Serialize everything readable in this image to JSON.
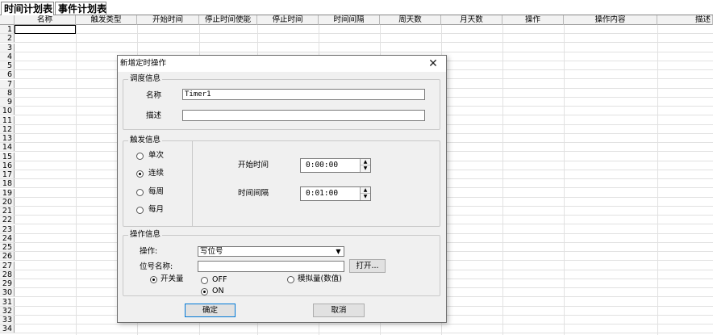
{
  "tabs": [
    {
      "label": "时间计划表",
      "active": true
    },
    {
      "label": "事件计划表",
      "active": false
    }
  ],
  "table": {
    "columns": [
      "名称",
      "触发类型",
      "开始时间",
      "停止时间使能",
      "停止时间",
      "时间间隔",
      "周天数",
      "月天数",
      "操作",
      "操作内容",
      "描述"
    ],
    "row_numbers": [
      "1",
      "2",
      "3",
      "4",
      "5",
      "6",
      "7",
      "8",
      "9",
      "10",
      "11",
      "12",
      "13",
      "14",
      "15",
      "16",
      "17",
      "18",
      "19",
      "20",
      "21",
      "22",
      "23",
      "24",
      "25",
      "26",
      "27",
      "28",
      "29",
      "30",
      "31",
      "32",
      "33",
      "34"
    ]
  },
  "dialog": {
    "title": "新增定时操作",
    "close_icon": "close-icon",
    "schedule_info": {
      "legend": "调度信息",
      "name_label": "名称",
      "name_value": "Timer1",
      "desc_label": "描述",
      "desc_value": ""
    },
    "trigger_info": {
      "legend": "触发信息",
      "options": [
        {
          "label": "单次",
          "selected": false
        },
        {
          "label": "连续",
          "selected": true
        },
        {
          "label": "每周",
          "selected": false
        },
        {
          "label": "每月",
          "selected": false
        }
      ],
      "start_time_label": "开始时间",
      "start_time_value": "0:00:00",
      "interval_label": "时间间隔",
      "interval_value": "0:01:00"
    },
    "operation_info": {
      "legend": "操作信息",
      "operation_label": "操作:",
      "operation_value": "写位号",
      "tag_name_label": "位号名称:",
      "tag_name_value": "",
      "open_button": "打开...",
      "switch_label": "开关量",
      "switch_selected": true,
      "off_label": "OFF",
      "off_selected": false,
      "on_label": "ON",
      "on_selected": true,
      "analog_label": "模拟量(数值)",
      "analog_selected": false
    },
    "ok_button": "确定",
    "cancel_button": "取消"
  }
}
